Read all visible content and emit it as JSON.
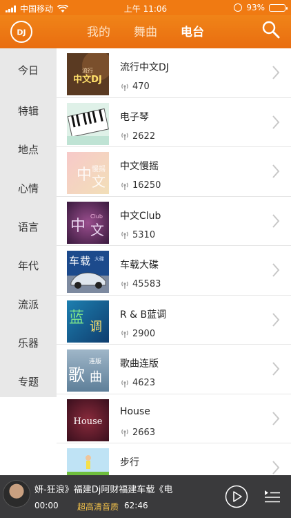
{
  "status_bar": {
    "carrier": "中国移动",
    "time": "上午 11:06",
    "battery": "93%"
  },
  "nav": {
    "tabs": [
      {
        "label": "我的",
        "active": false
      },
      {
        "label": "舞曲",
        "active": false
      },
      {
        "label": "电台",
        "active": true
      }
    ]
  },
  "sidebar": {
    "items": [
      "今日",
      "特辑",
      "地点",
      "心情",
      "语言",
      "年代",
      "流派",
      "乐器",
      "专题"
    ]
  },
  "stations": [
    {
      "title": "流行中文DJ",
      "listeners": "470",
      "art": "流行中文DJ"
    },
    {
      "title": "电子琴",
      "listeners": "2622",
      "art": ""
    },
    {
      "title": "中文慢摇",
      "listeners": "16250",
      "art": "中文慢摇"
    },
    {
      "title": "中文Club",
      "listeners": "5310",
      "art": "中文Club"
    },
    {
      "title": "车载大碟",
      "listeners": "45583",
      "art": "车载大碟"
    },
    {
      "title": "R & B蓝调",
      "listeners": "2900",
      "art": "蓝调"
    },
    {
      "title": "歌曲连版",
      "listeners": "4623",
      "art": "歌曲连版"
    },
    {
      "title": "House",
      "listeners": "2663",
      "art": "House"
    },
    {
      "title": "步行",
      "listeners": "",
      "art": ""
    }
  ],
  "player": {
    "track": "妍-狂浪》福建Dj阿财福建车载《电",
    "elapsed": "00:00",
    "quality": "超高清音质",
    "duration": "62:46"
  },
  "colors": {
    "brand_orange": "#f07a12",
    "player_bg": "#3a3a3c",
    "quality_gold": "#f3c24a"
  }
}
